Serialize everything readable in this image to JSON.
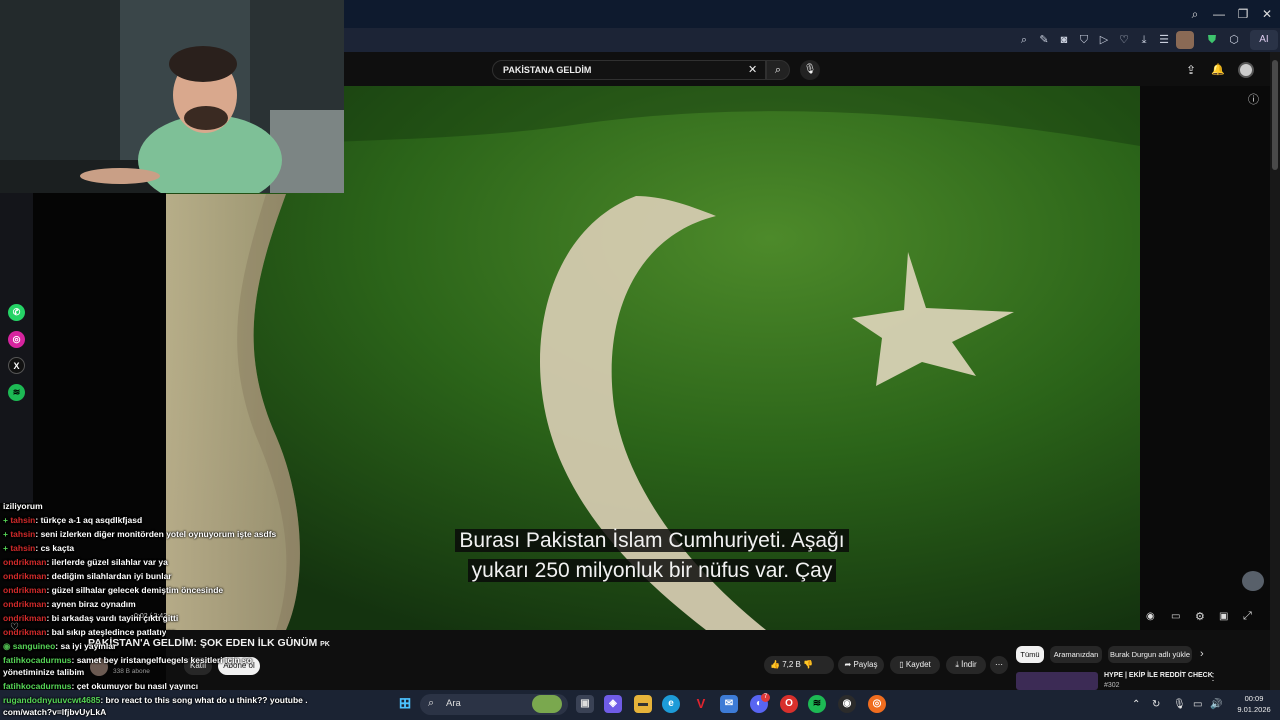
{
  "browser": {
    "toolbar_ai_label": "AI"
  },
  "youtube": {
    "search": {
      "value": "PAKİSTANA GELDİM"
    },
    "video": {
      "subtitle_line1": "Burası Pakistan İslam Cumhuriyeti. Aşağı",
      "subtitle_line2": "yukarı 250 milyonluk bir nüfus var. Çay",
      "title": "PAKİSTAN'A GELDİM: ŞOK EDEN İLK GÜNÜM",
      "title_flag": "PK",
      "time_partial": "0:02 / 2:42"
    },
    "channel": {
      "subs": "338 B abone",
      "join_label": "Katıl",
      "subscribe_label": "Abone ol"
    },
    "actions": {
      "likes": "7,2 B",
      "share": "Paylaş",
      "save": "Kaydet",
      "download": "İndir"
    },
    "chips": [
      "Tümü",
      "Aramanızdan",
      "Burak Durgun adlı yükle"
    ],
    "suggested": {
      "title": "HYPE | EKİP İLE REDDİT CHECK",
      "sub": "#302"
    }
  },
  "chat": {
    "lines": [
      {
        "user": "",
        "msg": "iziliyorum",
        "badge": ""
      },
      {
        "user": "tahsin",
        "msg": ": türkçe a-1 aq asqdlkfjasd",
        "badge": "+"
      },
      {
        "user": "tahsin",
        "msg": ": seni izlerken diğer monitörden yotel oynuyorum işte asdfs",
        "badge": "+"
      },
      {
        "user": "tahsin",
        "msg": ": cs kaçta",
        "badge": "+"
      },
      {
        "user": "ondrikman",
        "msg": ": ilerlerde güzel silahlar var ya",
        "badge": ""
      },
      {
        "user": "ondrikman",
        "msg": ": dediğim silahlardan iyi bunlar",
        "badge": ""
      },
      {
        "user": "ondrikman",
        "msg": ": güzel silhalar gelecek demiştim öncesinde",
        "badge": ""
      },
      {
        "user": "ondrikman",
        "msg": ": aynen biraz oynadım",
        "badge": ""
      },
      {
        "user": "ondrikman",
        "msg": ": bi arkadaş vardı tayini çıktı gitti",
        "badge": ""
      },
      {
        "user": "ondrikman",
        "msg": ": bal sıkıp ateşledince patlatıyor",
        "badge": ""
      },
      {
        "user": "sanguineo",
        "msg": ": sa iyi yayınlar",
        "badge": ""
      },
      {
        "user": "fatihkocadurmus",
        "msg": ": samet bey iristangelfuegels kesitleri için so",
        "badge": ""
      },
      {
        "user": "",
        "msg": "yönetiminize talibim",
        "badge": ""
      },
      {
        "user": "fatihkocadurmus",
        "msg": ": çet okumuyor bu nasıl yayıncı",
        "badge": ""
      },
      {
        "user": "rugandodnyuuvcwt4685",
        "msg": ": bro react to this song what do u think?? youtube .",
        "badge": ""
      },
      {
        "user": "",
        "msg": "com/watch?v=lfjbvUyLkA",
        "badge": ""
      }
    ]
  },
  "taskbar": {
    "search_placeholder": "Ara",
    "time": "00:09",
    "date": "9.01.2026",
    "badge_count": "7"
  },
  "colors": {
    "flag_green": "#1d4a16",
    "yt_bg": "#0f0f0f",
    "taskbar": "#1b2333",
    "chat_user": "#d02a2a"
  }
}
